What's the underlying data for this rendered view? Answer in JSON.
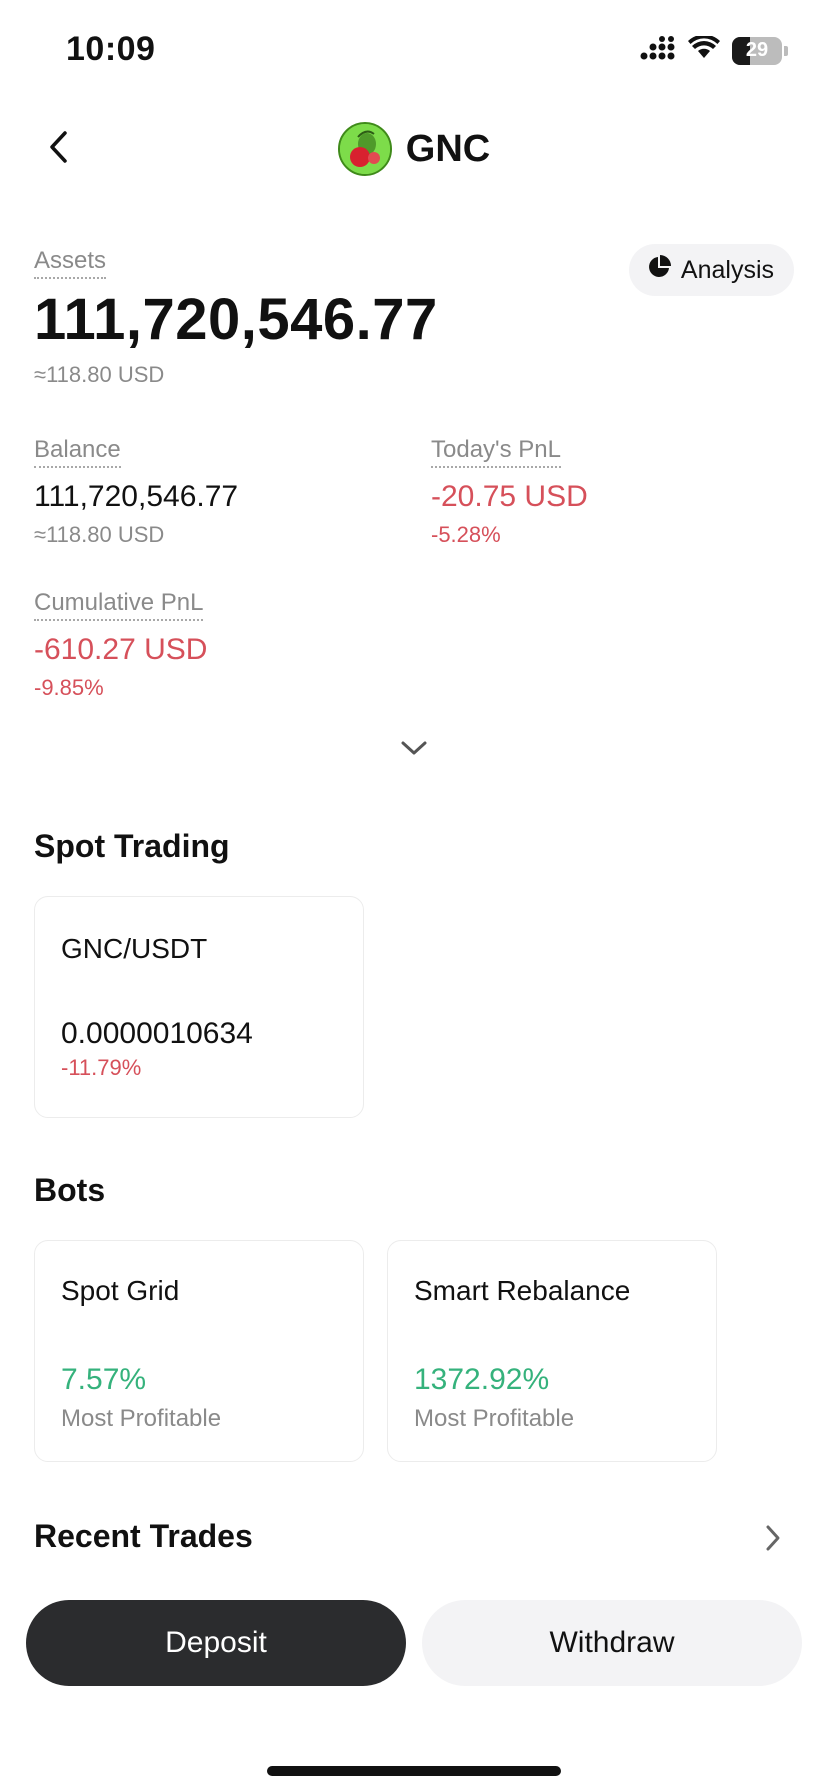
{
  "status_bar": {
    "time": "10:09",
    "battery": "29",
    "icons": [
      "signal-icon",
      "wifi-icon",
      "battery-icon"
    ]
  },
  "nav": {
    "title": "GNC",
    "back_icon": "chevron-left-icon",
    "logo_icon": "coin-logo"
  },
  "assets": {
    "label": "Assets",
    "value": "111,720,546.77",
    "usd": "≈118.80 USD",
    "analysis_label": "Analysis"
  },
  "stats": {
    "balance": {
      "label": "Balance",
      "value": "111,720,546.77",
      "sub": "≈118.80 USD"
    },
    "todays_pnl": {
      "label": "Today's PnL",
      "value": "-20.75 USD",
      "sub": "-5.28%"
    },
    "cumulative_pnl": {
      "label": "Cumulative PnL",
      "value": "-610.27 USD",
      "sub": "-9.85%"
    }
  },
  "spot_trading": {
    "title": "Spot Trading",
    "items": [
      {
        "pair": "GNC/USDT",
        "price": "0.0000010634",
        "change": "-11.79%"
      }
    ]
  },
  "bots": {
    "title": "Bots",
    "items": [
      {
        "name": "Spot Grid",
        "value": "7.57%",
        "sub": "Most Profitable"
      },
      {
        "name": "Smart Rebalance",
        "value": "1372.92%",
        "sub": "Most Profitable"
      }
    ]
  },
  "recent_trades": {
    "title": "Recent Trades"
  },
  "actions": {
    "deposit": "Deposit",
    "withdraw": "Withdraw"
  },
  "colors": {
    "negative": "#d6505a",
    "positive": "#35b27c",
    "primary_button": "#2b2c2e",
    "secondary_button": "#f3f3f5"
  }
}
